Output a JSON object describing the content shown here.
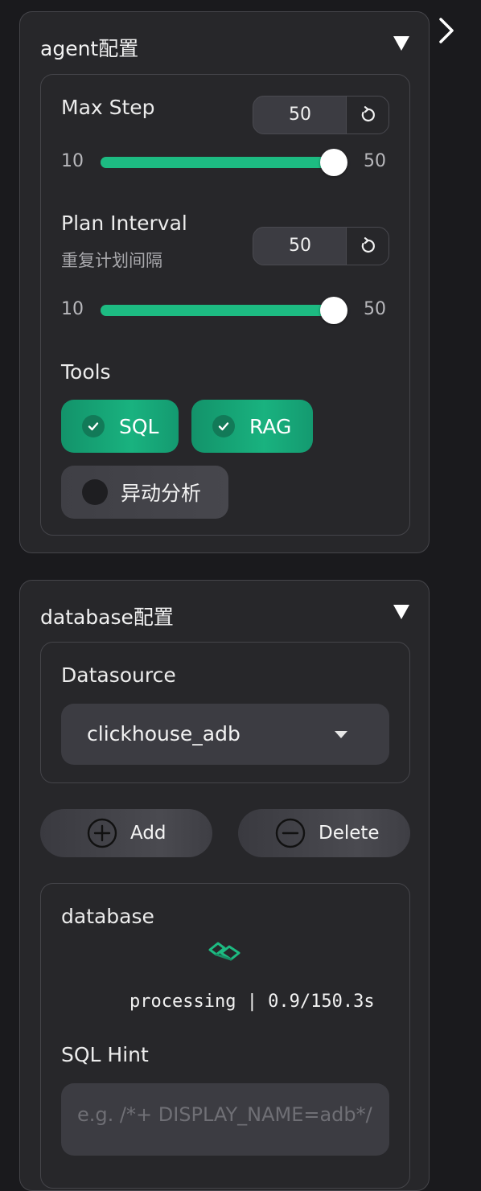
{
  "toggle": {
    "icon": "chevron-right-icon"
  },
  "agent": {
    "title": "agent配置",
    "max_step": {
      "label": "Max Step",
      "value": "50",
      "min": "10",
      "max": "50",
      "level": 1.0
    },
    "plan_interval": {
      "label": "Plan Interval",
      "sublabel": "重复计划间隔",
      "value": "50",
      "min": "10",
      "max": "50",
      "level": 1.0
    },
    "tools": {
      "label": "Tools",
      "items": [
        {
          "label": "SQL",
          "checked": true
        },
        {
          "label": "RAG",
          "checked": true
        },
        {
          "label": "异动分析",
          "checked": false
        }
      ]
    }
  },
  "database": {
    "title": "database配置",
    "datasource": {
      "label": "Datasource",
      "selected": "clickhouse_adb"
    },
    "add_label": "Add",
    "delete_label": "Delete",
    "db_section": {
      "label": "database",
      "status": "processing | 0.9/150.3s",
      "sql_hint_label": "SQL Hint",
      "sql_hint_placeholder": "e.g. /*+ DISPLAY_NAME=adb*/"
    }
  },
  "colors": {
    "accent": "#1dbb82",
    "panel": "#27272a",
    "background": "#1a1a1d"
  }
}
